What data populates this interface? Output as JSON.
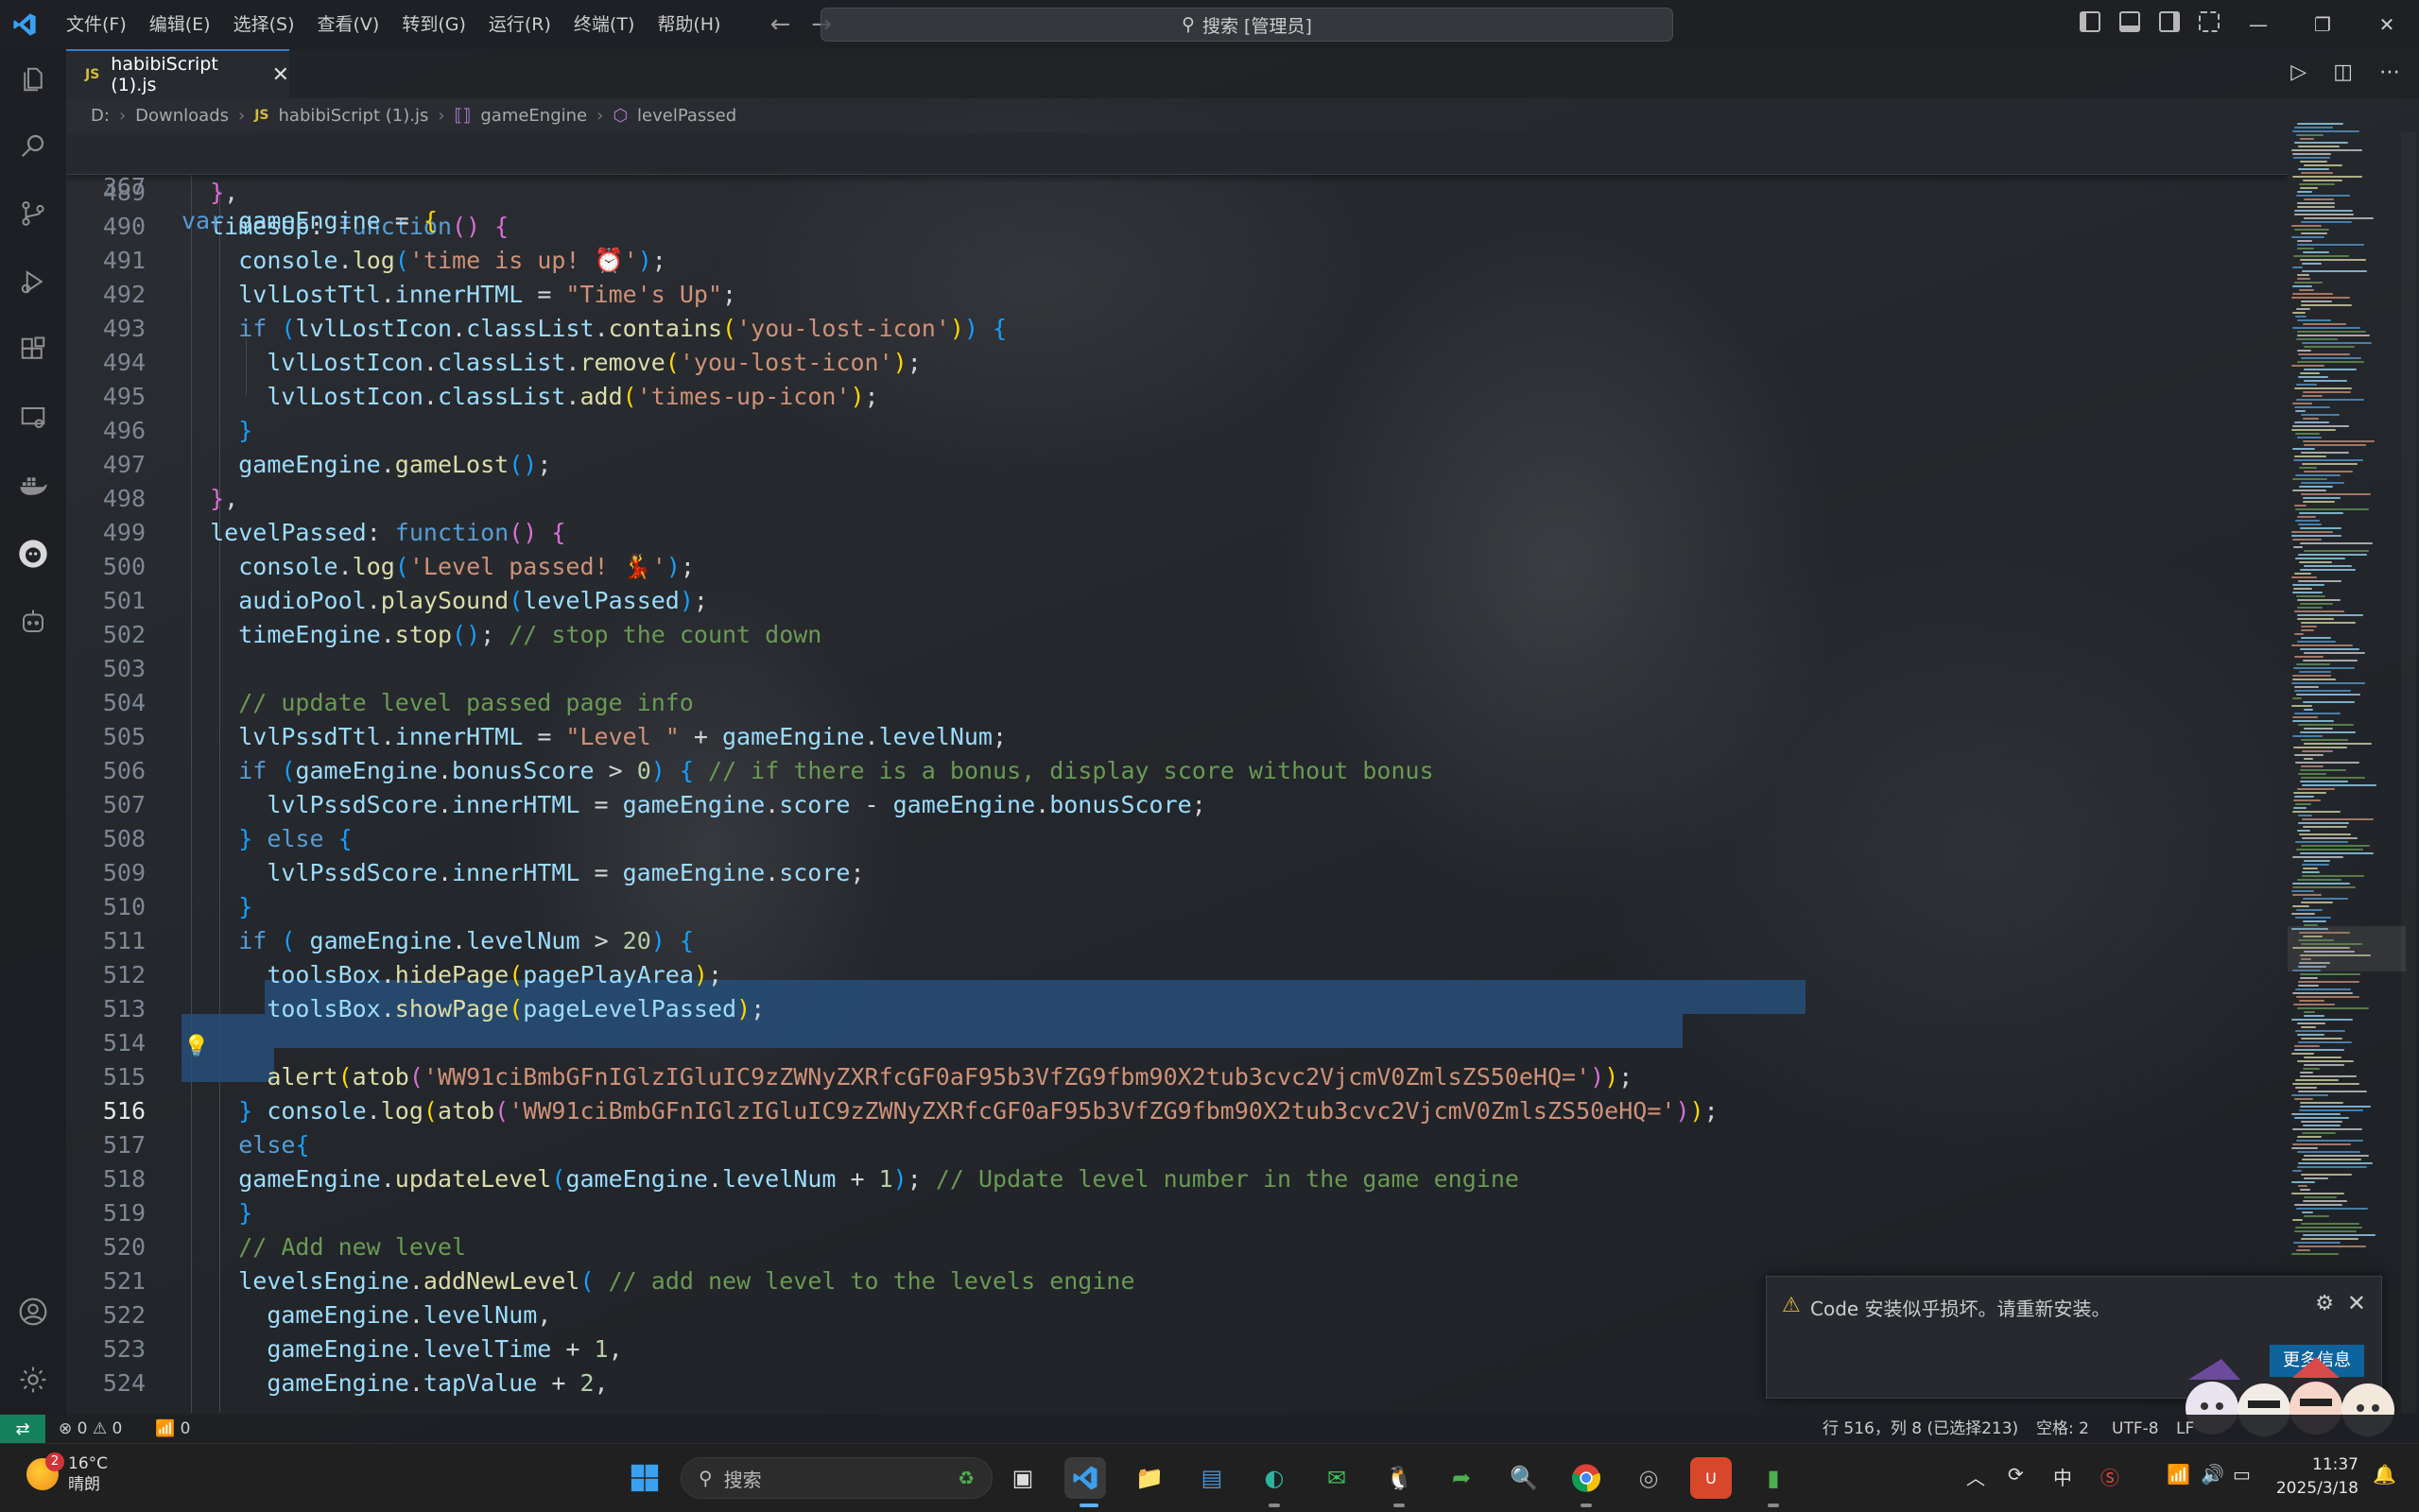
{
  "titlebar": {
    "menus": [
      "文件(F)",
      "编辑(E)",
      "选择(S)",
      "查看(V)",
      "转到(G)",
      "运行(R)",
      "终端(T)",
      "帮助(H)"
    ],
    "search": "搜索 [管理员]"
  },
  "tab": {
    "badge": "JS",
    "name": "habibiScript (1).js"
  },
  "breadcrumb": {
    "drive": "D:",
    "folder": "Downloads",
    "file": "habibiScript (1).js",
    "symbol1": "gameEngine",
    "symbol2": "levelPassed"
  },
  "sticky": {
    "line_number": "367"
  },
  "editor": {
    "line_numbers": [
      "489",
      "490",
      "491",
      "492",
      "493",
      "494",
      "495",
      "496",
      "497",
      "498",
      "499",
      "500",
      "501",
      "502",
      "503",
      "504",
      "505",
      "506",
      "507",
      "508",
      "509",
      "510",
      "511",
      "512",
      "513",
      "514",
      "515",
      "516",
      "517",
      "518",
      "519",
      "520",
      "521",
      "522",
      "523",
      "524"
    ],
    "current_line": "516",
    "strings": {
      "you_lost_icon": "'you-lost-icon'",
      "times_up_icon": "'times-up-icon'",
      "times_up_text": "\"Time's Up\"",
      "time_up_log": "'time is up! ⏰'",
      "level_passed_log": "'Level passed! 💃'",
      "level_prefix": "\"Level \"",
      "encoded": "'WW91ciBmbGFnIGlzIGluIC9zZWNyZXRfcGF0aF95b3VfZG9fbm90X2tub3cvc2VjcmV0ZmlsZS50eHQ='"
    },
    "comments": {
      "stop": "// stop the count down",
      "update_info": "// update level passed page info",
      "bonus": "// if there is a bonus, display score without bonus",
      "update_level": "// Update level number in the game engine",
      "add_level": "// Add new level",
      "add_to_engine": "// add new level to the levels engine"
    }
  },
  "notification": {
    "message": "Code 安装似乎损坏。请重新安装。",
    "button": "更多信息"
  },
  "statusbar": {
    "errors": "0",
    "warnings": "0",
    "ports": "0",
    "position": "行 516，列 8 (已选择213)",
    "spaces": "空格: 2",
    "encoding": "UTF-8",
    "eol": "LF"
  },
  "taskbar": {
    "weather_badge": "2",
    "temperature": "16°C",
    "condition": "晴朗",
    "search_placeholder": "搜索",
    "time": "11:37",
    "date": "2025/3/18",
    "input_method": "中"
  },
  "colors": {
    "keyword": "#569cd6",
    "function": "#dcdcaa",
    "string": "#ce9178",
    "property": "#9cdcfe",
    "comment": "#6a9955",
    "selection": "#264f78",
    "accent": "#2f80d0"
  }
}
